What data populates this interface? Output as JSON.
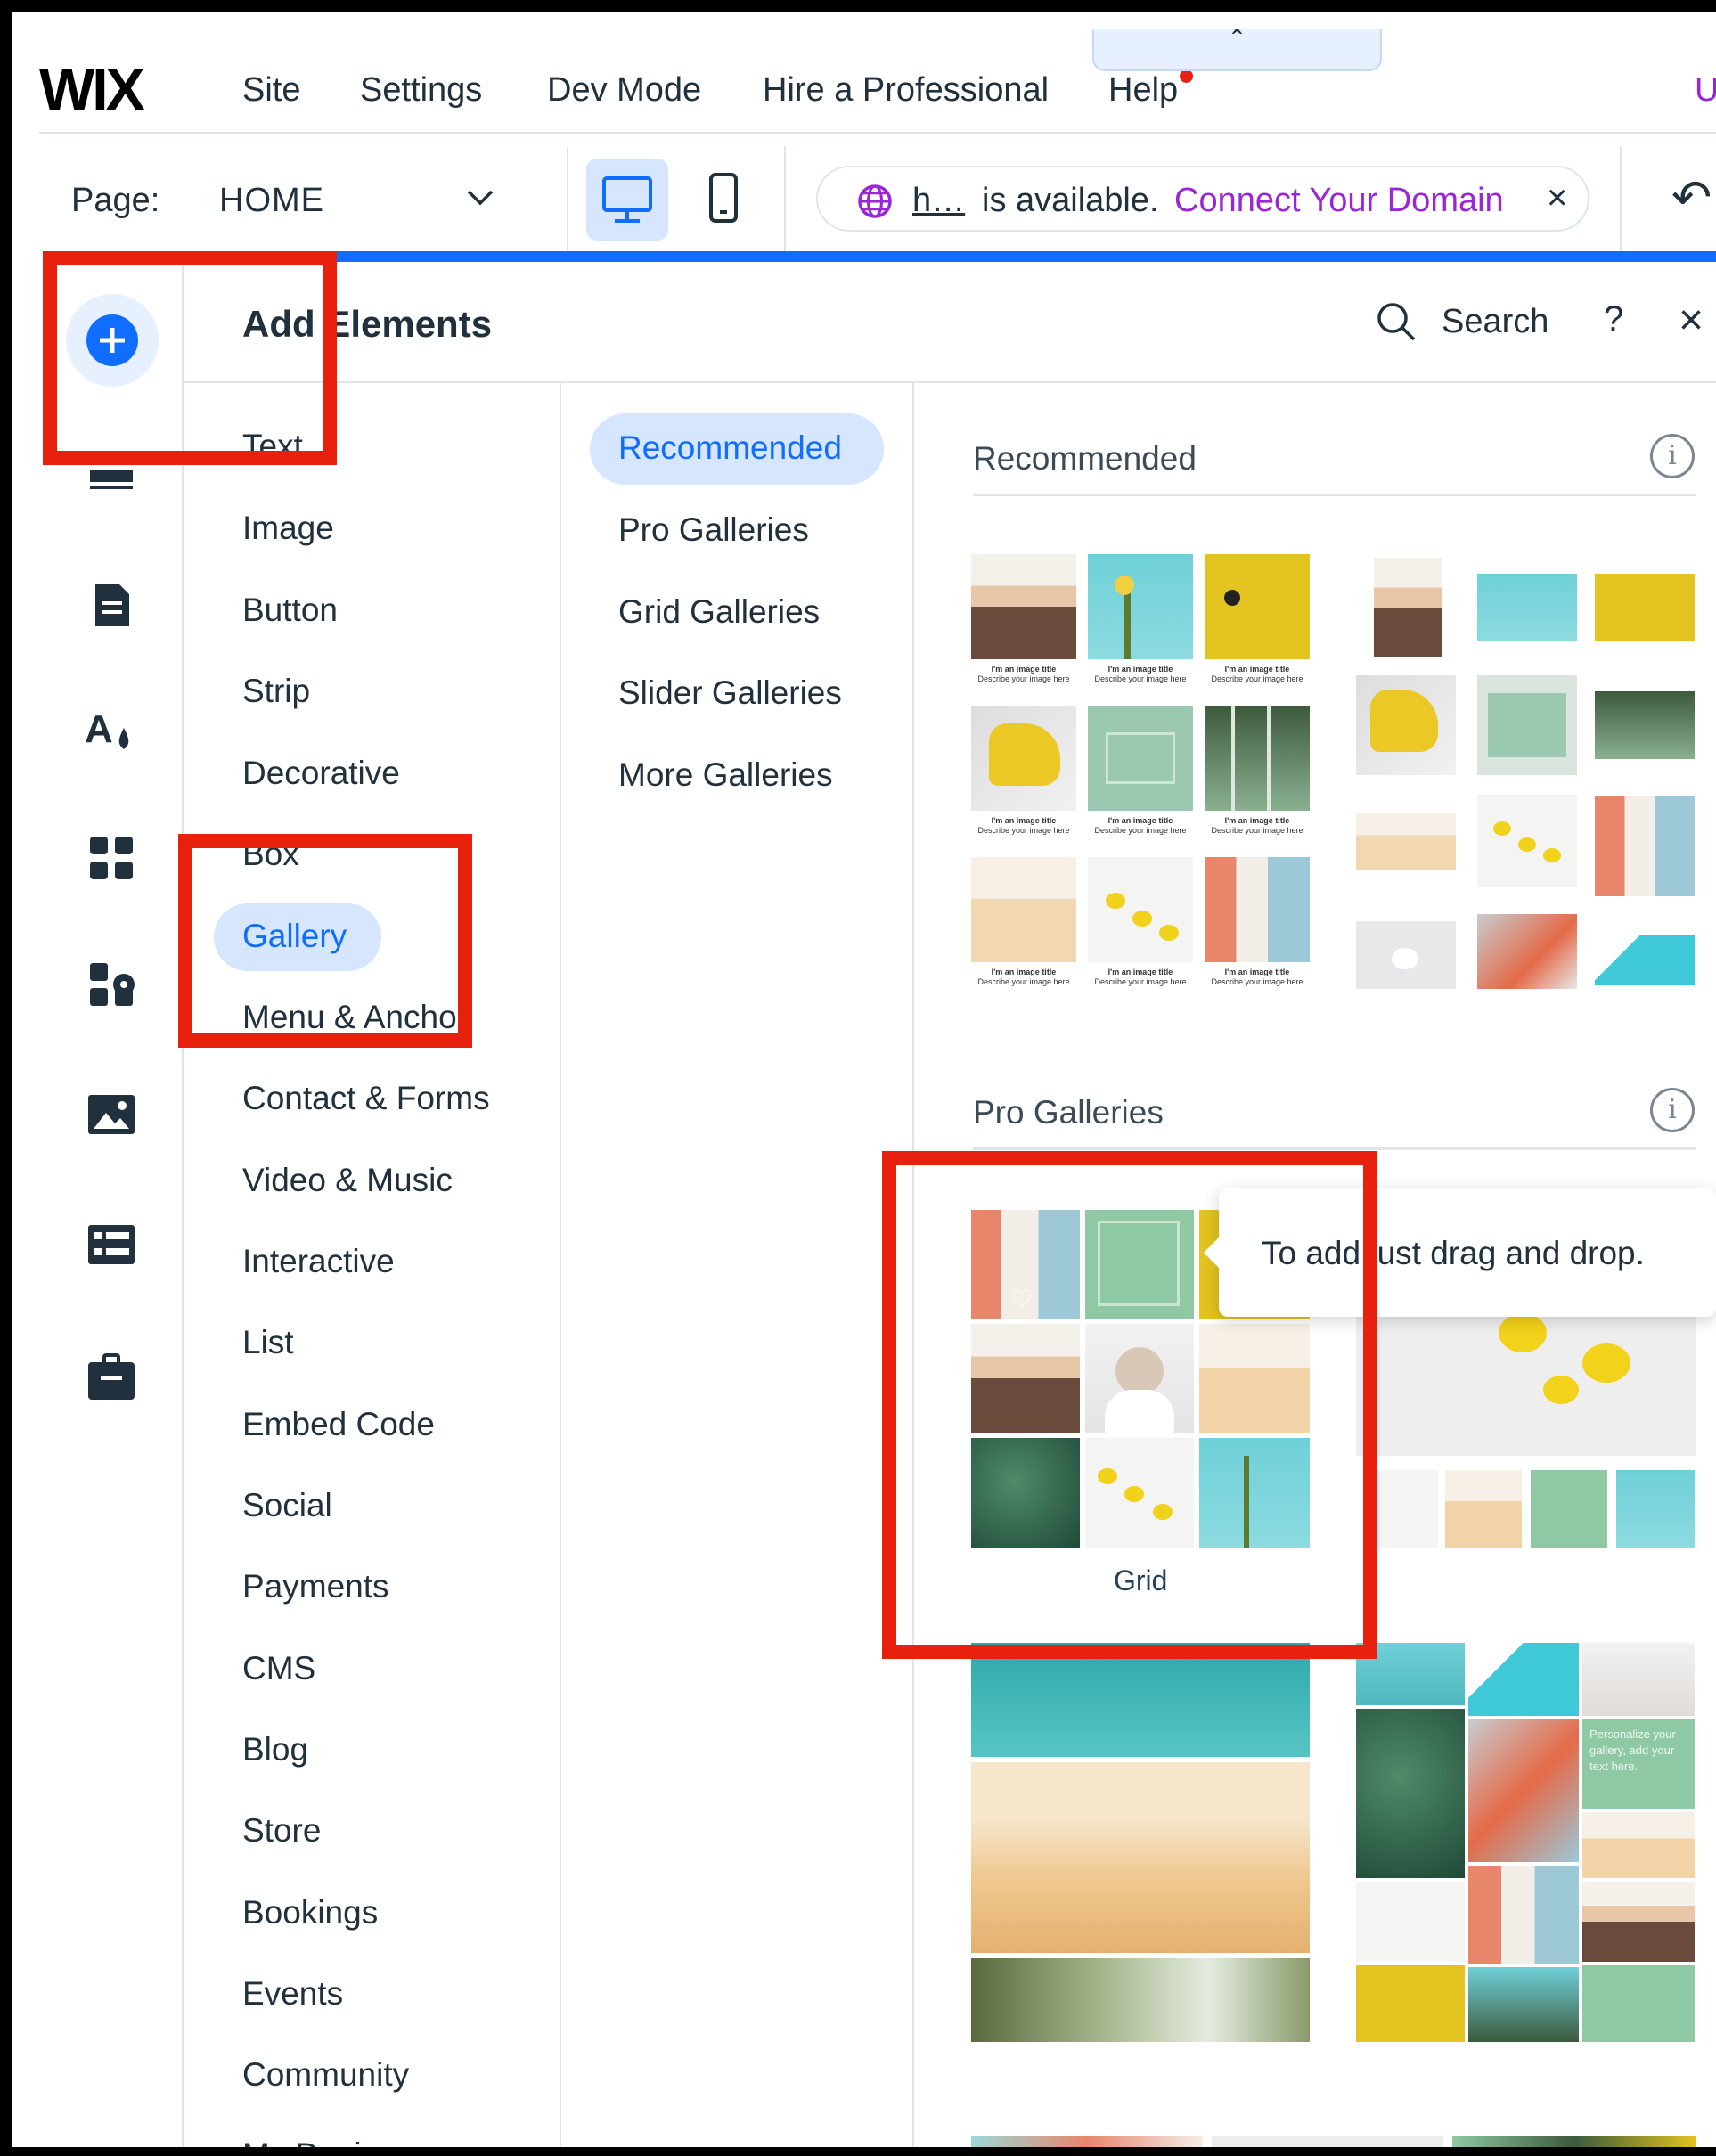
{
  "topbar": {
    "logo": "WIX",
    "menu": [
      "Site",
      "Settings",
      "Dev Mode",
      "Hire a Professional",
      "Help"
    ],
    "collapse_glyph": "ˆ",
    "upgrade_label": "Up"
  },
  "pagebar": {
    "page_label": "Page:",
    "page_name": "HOME",
    "domain_prefix": "h…",
    "domain_available": "is available.",
    "connect_label": "Connect Your Domain",
    "close_glyph": "×",
    "undo_glyph": "↶"
  },
  "panel": {
    "title": "Add Elements",
    "search_label": "Search",
    "help_glyph": "?",
    "close_glyph": "×"
  },
  "categories": [
    "Text",
    "Image",
    "Button",
    "Strip",
    "Decorative",
    "Box",
    "Gallery",
    "Menu & Anchor",
    "Contact & Forms",
    "Video & Music",
    "Interactive",
    "List",
    "Embed Code",
    "Social",
    "Payments",
    "CMS",
    "Blog",
    "Store",
    "Bookings",
    "Events",
    "Community",
    "My Designs"
  ],
  "active_category": "Gallery",
  "subcategories": [
    "Recommended",
    "Pro Galleries",
    "Grid Galleries",
    "Slider Galleries",
    "More Galleries"
  ],
  "active_subcategory": "Recommended",
  "sections": {
    "recommended_title": "Recommended",
    "pro_title": "Pro Galleries",
    "info_glyph": "i"
  },
  "thumbs": {
    "image_title": "I'm an image title",
    "image_desc": "Describe your image here",
    "personalize_text": "Personalize your gallery, add your text here."
  },
  "tooltip": {
    "text": "To add just drag and drop."
  },
  "grid_caption": "Grid",
  "colors": {
    "accent_blue": "#116dff",
    "active_bg": "#d6e6fe",
    "upgrade_purple": "#9a27d5",
    "highlight_red": "#e8210f"
  }
}
